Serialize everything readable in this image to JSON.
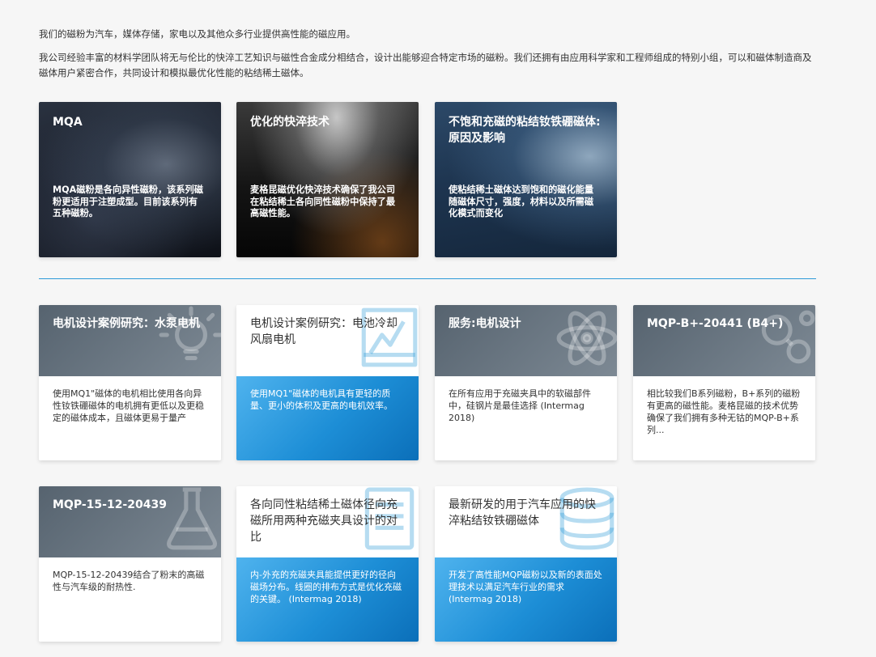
{
  "intro": {
    "line1": "我们的磁粉为汽车，媒体存储，家电以及其他众多行业提供高性能的磁应用。",
    "line2": "我公司经验丰富的材料学团队将无与伦比的快淬工艺知识与磁性合金成分相结合，设计出能够迎合特定市场的磁粉。我们还拥有由应用科学家和工程师组成的特别小组，可以和磁体制造商及磁体用户紧密合作，共同设计和模拟最优化性能的粘结稀土磁体。"
  },
  "feature_cards": [
    {
      "title": "MQA",
      "desc": "MQA磁粉是各向异性磁粉，该系列磁粉更适用于注塑成型。目前该系列有五种磁粉。"
    },
    {
      "title": "优化的快淬技术",
      "desc": "麦格昆磁优化快淬技术确保了我公司在粘结稀土各向同性磁粉中保持了最高磁性能。"
    },
    {
      "title": "不饱和充磁的粘结钕铁硼磁体: 原因及影响",
      "desc": "使粘结稀土磁体达到饱和的磁化能量随磁体尺寸，强度，材料以及所需磁化模式而变化"
    }
  ],
  "cases": [
    {
      "title": "电机设计案例研究：水泵电机",
      "desc": "使用MQ1\"磁体的电机相比使用各向异性钕铁硼磁体的电机拥有更低以及更稳定的磁体成本，且磁体更易于量产",
      "icon": "lightbulb-icon"
    },
    {
      "title": "电机设计案例研究：电池冷却风扇电机",
      "desc": "使用MQ1\"磁体的电机具有更轻的质量、更小的体积及更高的电机效率。",
      "icon": "chart-icon"
    },
    {
      "title": "服务:电机设计",
      "desc": "在所有应用于充磁夹具中的软磁部件中，硅钢片是最佳选择 (Intermag 2018)",
      "icon": "atom-icon"
    },
    {
      "title": "MQP-B+-20441 (B4+)",
      "desc": "相比较我们B系列磁粉，B+系列的磁粉有更高的磁性能。麦格昆磁的技术优势确保了我们拥有多种无钴的MQP-B+系列...",
      "icon": "magnet-icon"
    },
    {
      "title": "MQP-15-12-20439",
      "desc": "MQP-15-12-20439结合了粉末的高磁性与汽车级的耐热性.",
      "icon": "flask-icon"
    },
    {
      "title": "各向同性粘结稀土磁体径向充磁所用两种充磁夹具设计的对比",
      "desc": "内-外充的充磁夹具能提供更好的径向磁场分布。线圈的排布方式是优化充磁的关键。 (Intermag 2018)",
      "icon": "document-icon"
    },
    {
      "title": "最新研发的用于汽车应用的快淬粘结钕铁硼磁体",
      "desc": "开发了高性能MQP磁粉以及新的表面处理技术以满足汽车行业的需求 (Intermag 2018)",
      "icon": "database-icon"
    }
  ],
  "colors": {
    "accent_blue": "#1d8ed6",
    "divider": "#2e9ad8",
    "card_head_dark": "#5d6a76"
  }
}
